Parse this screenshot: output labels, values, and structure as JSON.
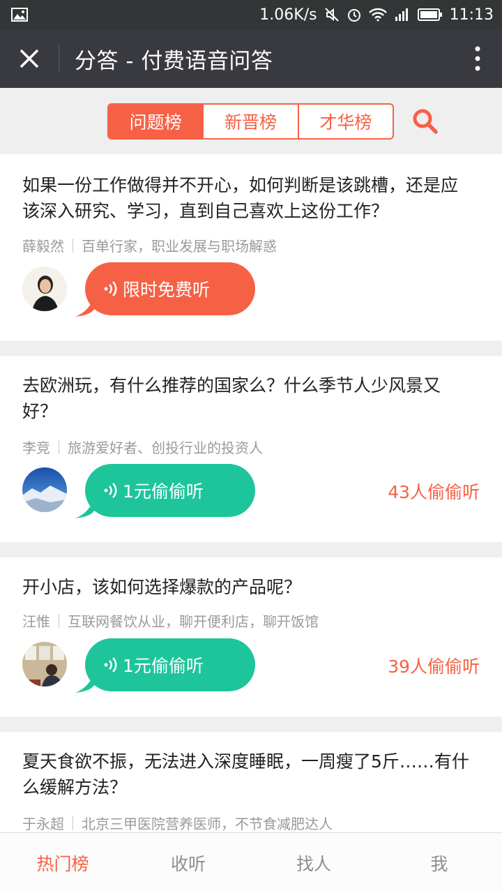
{
  "status_bar": {
    "speed": "1.06K/s",
    "time": "11:13"
  },
  "app_bar": {
    "title": "分答 - 付费语音问答"
  },
  "tabs": [
    {
      "label": "问题榜",
      "active": true
    },
    {
      "label": "新晋榜",
      "active": false
    },
    {
      "label": "才华榜",
      "active": false
    }
  ],
  "questions": [
    {
      "title": "如果一份工作做得并不开心，如何判断是该跳槽，还是应该深入研究、学习，直到自己喜欢上这份工作？",
      "author": "薛毅然",
      "author_desc": "百单行家，职业发展与职场解惑",
      "button_label": "限时免费听",
      "button_color": "#f66145",
      "listeners": ""
    },
    {
      "title": "去欧洲玩，有什么推荐的国家么？什么季节人少风景又好？",
      "author": "李竞",
      "author_desc": "旅游爱好者、创投行业的投资人",
      "button_label": "1元偷偷听",
      "button_color": "#1ec59a",
      "listeners": "43人偷偷听"
    },
    {
      "title": "开小店，该如何选择爆款的产品呢？",
      "author": "汪惟",
      "author_desc": "互联网餐饮从业，聊开便利店，聊开饭馆",
      "button_label": "1元偷偷听",
      "button_color": "#1ec59a",
      "listeners": "39人偷偷听"
    },
    {
      "title": "夏天食欲不振，无法进入深度睡眠，一周瘦了5斤……有什么缓解方法？",
      "author": "于永超",
      "author_desc": "北京三甲医院营养医师，不节食减肥达人",
      "button_label": "",
      "button_color": "",
      "listeners": ""
    }
  ],
  "bottom_nav": [
    {
      "label": "热门榜",
      "active": true
    },
    {
      "label": "收听",
      "active": false
    },
    {
      "label": "找人",
      "active": false
    },
    {
      "label": "我",
      "active": false
    }
  ],
  "colors": {
    "accent": "#f66145",
    "green": "#1ec59a",
    "header": "#393a3f"
  }
}
